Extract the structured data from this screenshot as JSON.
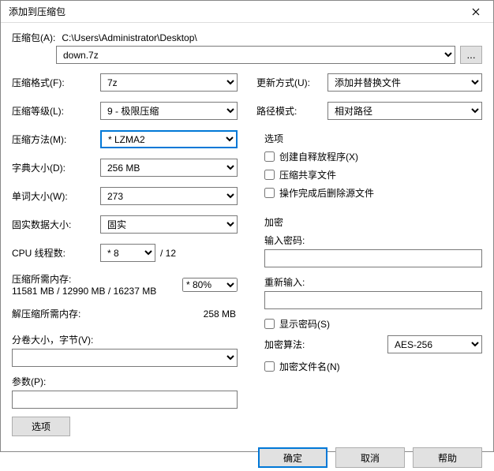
{
  "title": "添加到压缩包",
  "archive": {
    "label": "压缩包(A):",
    "path": "C:\\Users\\Administrator\\Desktop\\",
    "filename": "down.7z",
    "browse": "..."
  },
  "left": {
    "format": {
      "label": "压缩格式(F):",
      "value": "7z"
    },
    "level": {
      "label": "压缩等级(L):",
      "value": "9 - 极限压缩"
    },
    "method": {
      "label": "压缩方法(M):",
      "value": "LZMA2"
    },
    "dict": {
      "label": "字典大小(D):",
      "value": "256 MB"
    },
    "word": {
      "label": "单词大小(W):",
      "value": "273"
    },
    "solid": {
      "label": "固实数据大小:",
      "value": "固实"
    },
    "threads": {
      "label": "CPU 线程数:",
      "value": "8",
      "suffix": "/ 12"
    },
    "mem_compress": {
      "label": "压缩所需内存:",
      "value": "11581 MB / 12990 MB / 16237 MB",
      "pct": "80%"
    },
    "mem_decompress": {
      "label": "解压缩所需内存:",
      "value": "258 MB"
    },
    "split": {
      "label": "分卷大小，字节(V):"
    },
    "params": {
      "label": "参数(P):"
    },
    "options_btn": "选项"
  },
  "right": {
    "update": {
      "label": "更新方式(U):",
      "value": "添加并替换文件"
    },
    "path_mode": {
      "label": "路径模式:",
      "value": "相对路径"
    },
    "options_title": "选项",
    "sfx": "创建自释放程序(X)",
    "shared": "压缩共享文件",
    "delete_after": "操作完成后删除源文件",
    "encrypt_title": "加密",
    "pw1": "输入密码:",
    "pw2": "重新输入:",
    "show_pw": "显示密码(S)",
    "algo": {
      "label": "加密算法:",
      "value": "AES-256"
    },
    "encrypt_names": "加密文件名(N)"
  },
  "footer": {
    "ok": "确定",
    "cancel": "取消",
    "help": "帮助"
  }
}
